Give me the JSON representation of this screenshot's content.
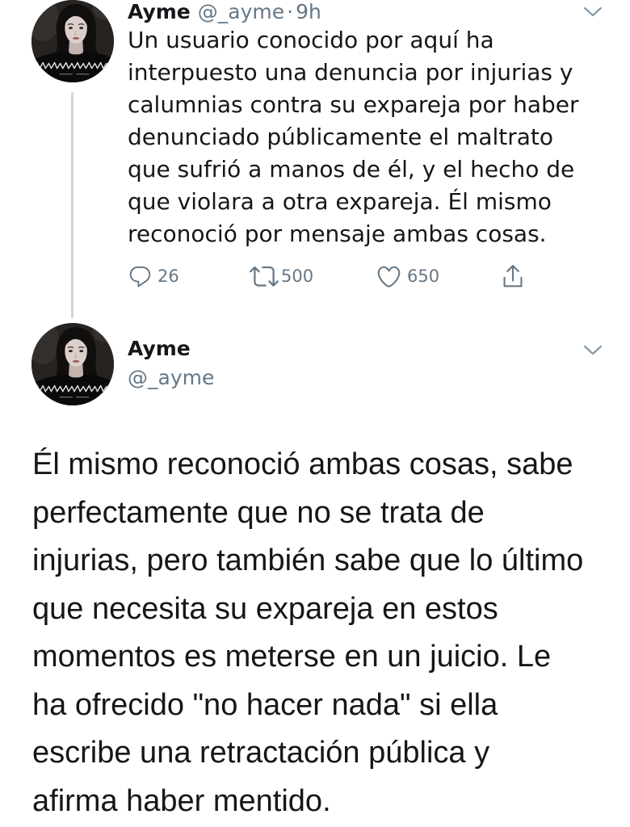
{
  "colors": {
    "text": "#14171a",
    "secondary": "#657786",
    "thread_line": "#ccd6dd",
    "chevron": "#8899a6",
    "background": "#ffffff"
  },
  "tweets": [
    {
      "author": {
        "name": "Ayme",
        "handle": "@_ayme"
      },
      "separator": "·",
      "time": "9h",
      "menu_icon": "chevron-down-icon",
      "body_lines": [
        "Un usuario conocido por aquí ha",
        "interpuesto una denuncia por injurias y",
        "calumnias contra su expareja por haber",
        "denunciado públicamente el maltrato",
        "que sufrió a manos de él, y el hecho de",
        "que violara a otra expareja. Él mismo",
        "reconoció por mensaje ambas cosas."
      ],
      "actions": {
        "reply": {
          "icon": "reply-icon",
          "count": "26"
        },
        "retweet": {
          "icon": "retweet-icon",
          "count": "500"
        },
        "like": {
          "icon": "heart-icon",
          "count": "650"
        },
        "share": {
          "icon": "share-icon"
        }
      }
    },
    {
      "author": {
        "name": "Ayme",
        "handle": "@_ayme"
      },
      "menu_icon": "chevron-down-icon",
      "body_lines": [
        "Él mismo reconoció ambas cosas, sabe",
        "perfectamente que no se trata de",
        "injurias, pero también sabe que lo último",
        "que necesita su expareja en estos",
        "momentos es meterse en un juicio. Le",
        "ha ofrecido \"no hacer nada\" si ella",
        "escribe una retractación pública y",
        "afirma haber mentido."
      ]
    }
  ]
}
